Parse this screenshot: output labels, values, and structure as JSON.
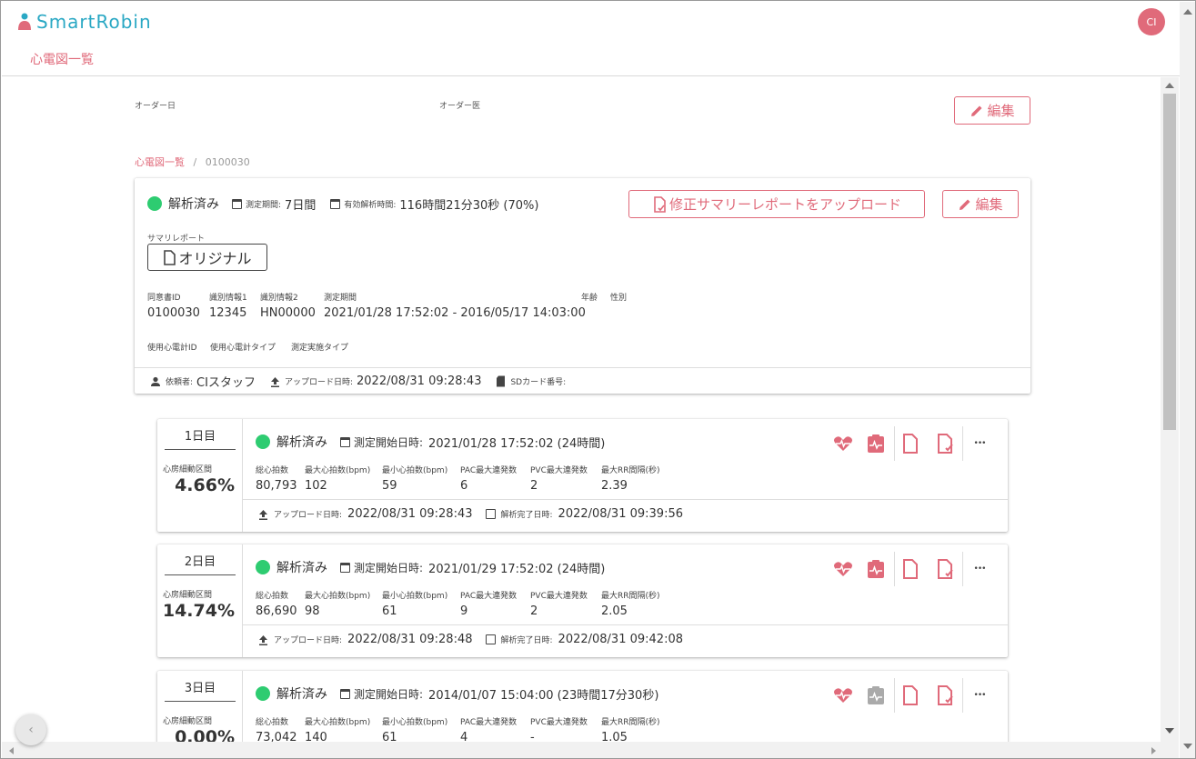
{
  "app": {
    "name": "SmartRobin",
    "page_title": "心電図一覧",
    "avatar_initials": "CI"
  },
  "colors": {
    "accent": "#e06a7a",
    "brand": "#2aa8c4",
    "status_ok": "#2ecc71"
  },
  "order": {
    "date_label": "オーダー日",
    "doctor_label": "オーダー医",
    "edit_label": "編集"
  },
  "breadcrumb": {
    "parent": "心電図一覧",
    "separator": "/",
    "current": "0100030"
  },
  "summary": {
    "status": "解析済み",
    "period_label": "測定期間:",
    "period_value": "7日間",
    "effective_label": "有効解析時間:",
    "effective_value": "116時間21分30秒 (70%)",
    "upload_button": "修正サマリーレポートをアップロード",
    "edit_button": "編集",
    "report_label": "サマリレポート",
    "original_button": "オリジナル",
    "fields": [
      {
        "label": "同意書ID",
        "value": "0100030"
      },
      {
        "label": "識別情報1",
        "value": "12345"
      },
      {
        "label": "識別情報2",
        "value": "HN00000"
      },
      {
        "label": "測定期間",
        "value": "2021/01/28 17:52:02 - 2016/05/17 14:03:00"
      },
      {
        "label": "年齢",
        "value": ""
      },
      {
        "label": "性別",
        "value": ""
      }
    ],
    "device_fields": [
      {
        "label": "使用心電計ID",
        "value": ""
      },
      {
        "label": "使用心電計タイプ",
        "value": ""
      },
      {
        "label": "測定実施タイプ",
        "value": ""
      }
    ],
    "footer": {
      "requester_label": "依頼者:",
      "requester_value": "CIスタッフ",
      "upload_label": "アップロード日時:",
      "upload_value": "2022/08/31 09:28:43",
      "sd_label": "SDカード番号:",
      "sd_value": ""
    }
  },
  "day_labels": {
    "af_label": "心房細動区間",
    "start_label": "測定開始日時:",
    "upload_label": "アップロード日時:",
    "done_label": "解析完了日時:",
    "col_total": "総心拍数",
    "col_max": "最大心拍数(bpm)",
    "col_min": "最小心拍数(bpm)",
    "col_pac": "PAC最大連発数",
    "col_pvc": "PVC最大連発数",
    "col_rr": "最大RR間隔(秒)",
    "more": "•••"
  },
  "days": [
    {
      "name": "1日目",
      "af": "4.66%",
      "status": "解析済み",
      "start": "2021/01/28 17:52:02 (24時間)",
      "total": "80,793",
      "max": "102",
      "min": "59",
      "pac": "6",
      "pvc": "2",
      "rr": "2.39",
      "upload": "2022/08/31 09:28:43",
      "done": "2022/08/31 09:39:56"
    },
    {
      "name": "2日目",
      "af": "14.74%",
      "status": "解析済み",
      "start": "2021/01/29 17:52:02 (24時間)",
      "total": "86,690",
      "max": "98",
      "min": "61",
      "pac": "9",
      "pvc": "2",
      "rr": "2.05",
      "upload": "2022/08/31 09:28:48",
      "done": "2022/08/31 09:42:08"
    },
    {
      "name": "3日目",
      "af": "0.00%",
      "status": "解析済み",
      "start": "2014/01/07 15:04:00 (23時間17分30秒)",
      "total": "73,042",
      "max": "140",
      "min": "61",
      "pac": "4",
      "pvc": "-",
      "rr": "1.05",
      "upload": "",
      "done": ""
    }
  ]
}
